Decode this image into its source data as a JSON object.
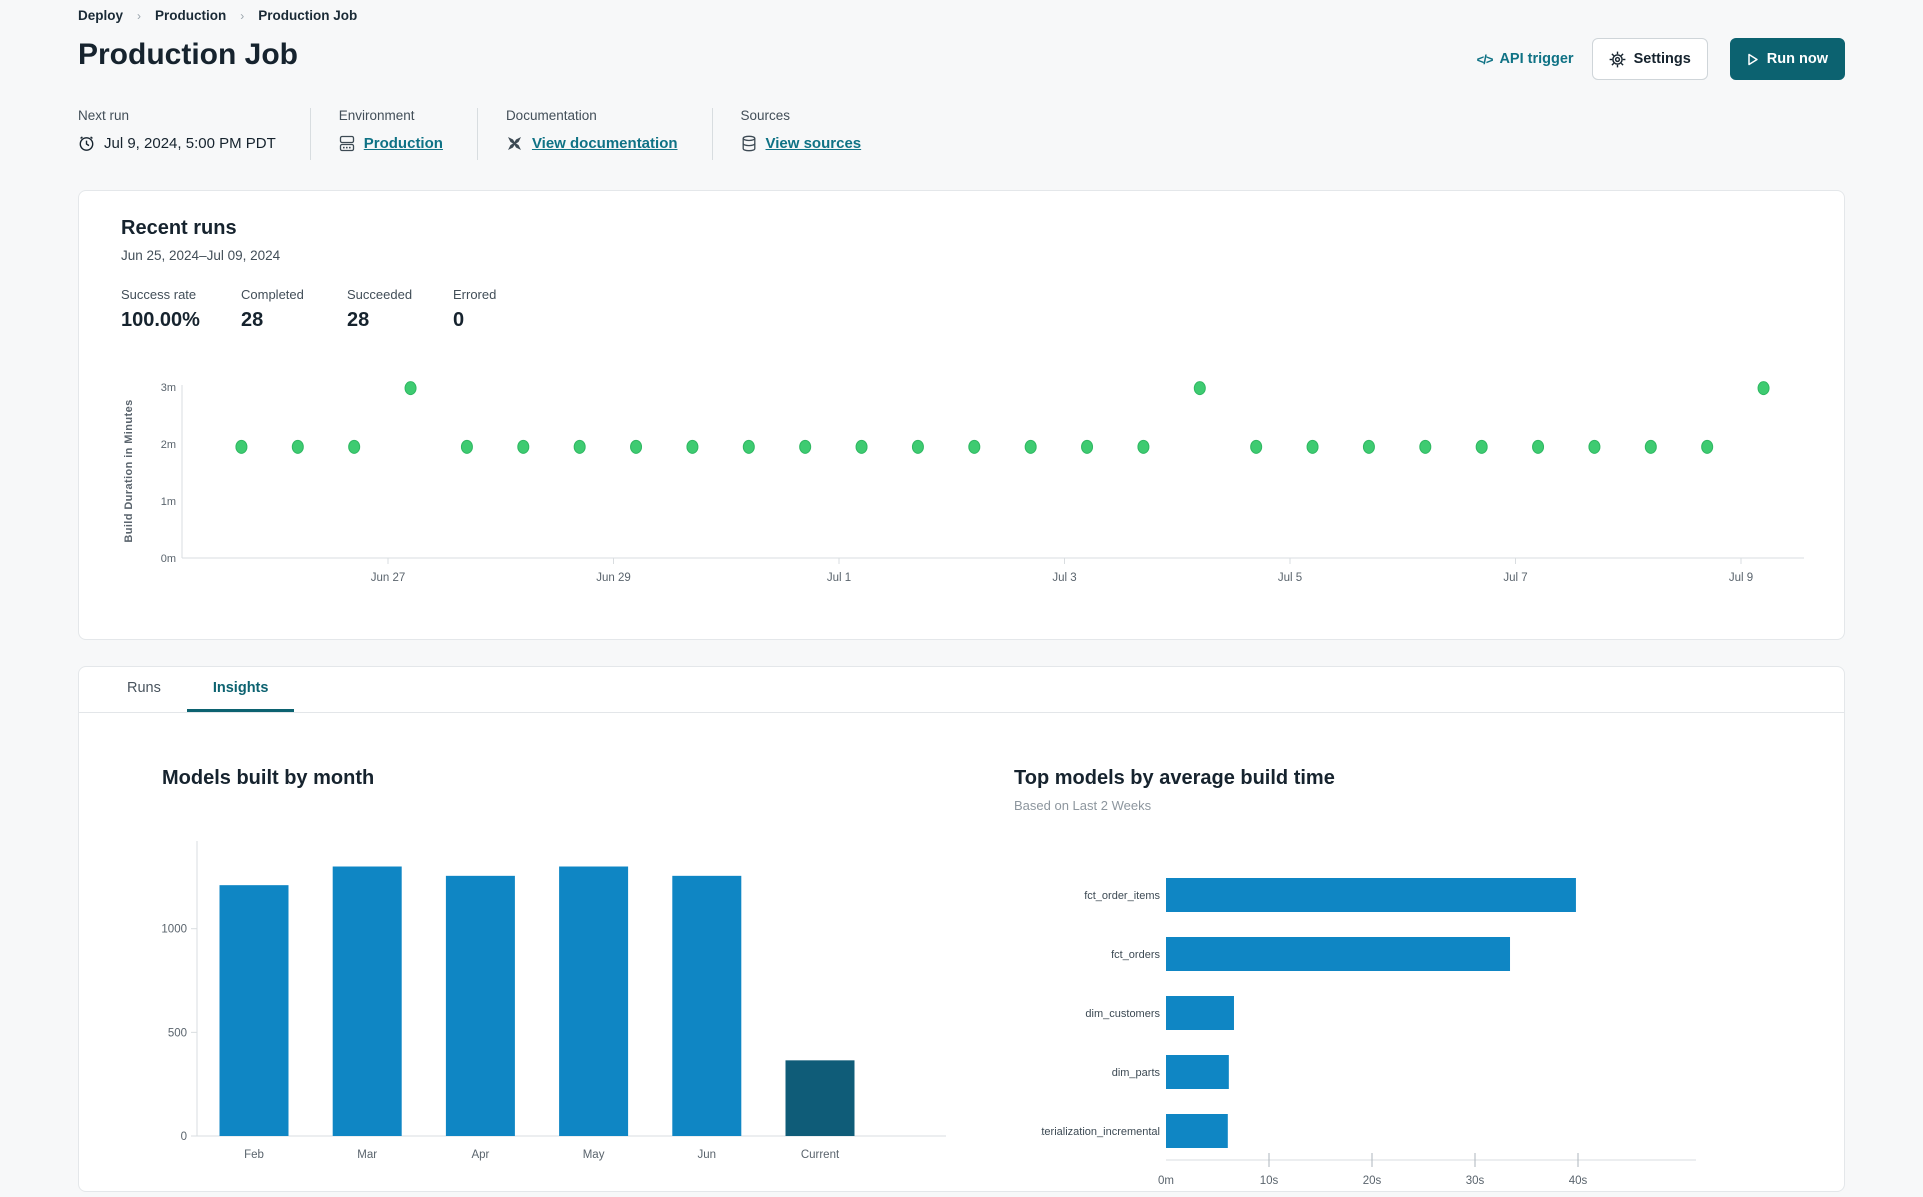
{
  "breadcrumb": {
    "items": [
      {
        "label": "Deploy"
      },
      {
        "label": "Production"
      },
      {
        "label": "Production Job"
      }
    ]
  },
  "header": {
    "title": "Production Job",
    "api_trigger_label": "API trigger",
    "api_trigger_glyph": "</>",
    "settings_label": "Settings",
    "run_now_label": "Run now"
  },
  "meta": {
    "next_run": {
      "label": "Next run",
      "value": "Jul 9, 2024, 5:00 PM PDT"
    },
    "environment": {
      "label": "Environment",
      "value": "Production"
    },
    "documentation": {
      "label": "Documentation",
      "value": "View documentation"
    },
    "sources": {
      "label": "Sources",
      "value": "View sources"
    }
  },
  "recent_runs": {
    "title": "Recent runs",
    "date_range": "Jun 25, 2024–Jul 09, 2024",
    "stats": [
      {
        "label": "Success rate",
        "value": "100.00%"
      },
      {
        "label": "Completed",
        "value": "28"
      },
      {
        "label": "Succeeded",
        "value": "28"
      },
      {
        "label": "Errored",
        "value": "0"
      }
    ]
  },
  "tabs": [
    {
      "label": "Runs",
      "active": false
    },
    {
      "label": "Insights",
      "active": true
    }
  ],
  "colors": {
    "accent_teal": "#0c6270",
    "link_teal": "#0f7285",
    "dot_green": "#3ecb71",
    "dot_green_edge": "#2fb862",
    "bar_blue": "#0f86c4",
    "bar_current_dark": "#0f5c78",
    "axis_text": "#5a646d",
    "axis_line": "#d9dde0"
  },
  "chart_data": [
    {
      "id": "build-duration-scatter",
      "type": "scatter",
      "ylabel": "Build Duration in Minutes",
      "y_ticks": [
        {
          "label": "0m",
          "minutes": 0
        },
        {
          "label": "1m",
          "minutes": 1
        },
        {
          "label": "2m",
          "minutes": 2
        },
        {
          "label": "3m",
          "minutes": 3
        }
      ],
      "x_ticks": [
        {
          "label": "Jun 27",
          "day": 2
        },
        {
          "label": "Jun 29",
          "day": 4
        },
        {
          "label": "Jul 1",
          "day": 6
        },
        {
          "label": "Jul 3",
          "day": 8
        },
        {
          "label": "Jul 5",
          "day": 10
        },
        {
          "label": "Jul 7",
          "day": 12
        },
        {
          "label": "Jul 9",
          "day": 14
        }
      ],
      "ylim": [
        0,
        3.2
      ],
      "points": [
        {
          "day": 0.7,
          "minutes": 1.95
        },
        {
          "day": 1.2,
          "minutes": 1.95
        },
        {
          "day": 1.7,
          "minutes": 1.95
        },
        {
          "day": 2.2,
          "minutes": 2.98
        },
        {
          "day": 2.7,
          "minutes": 1.95
        },
        {
          "day": 3.2,
          "minutes": 1.95
        },
        {
          "day": 3.7,
          "minutes": 1.95
        },
        {
          "day": 4.2,
          "minutes": 1.95
        },
        {
          "day": 4.7,
          "minutes": 1.95
        },
        {
          "day": 5.2,
          "minutes": 1.95
        },
        {
          "day": 5.7,
          "minutes": 1.95
        },
        {
          "day": 6.2,
          "minutes": 1.95
        },
        {
          "day": 6.7,
          "minutes": 1.95
        },
        {
          "day": 7.2,
          "minutes": 1.95
        },
        {
          "day": 7.7,
          "minutes": 1.95
        },
        {
          "day": 8.2,
          "minutes": 1.95
        },
        {
          "day": 8.7,
          "minutes": 1.95
        },
        {
          "day": 9.2,
          "minutes": 2.98
        },
        {
          "day": 9.7,
          "minutes": 1.95
        },
        {
          "day": 10.2,
          "minutes": 1.95
        },
        {
          "day": 10.7,
          "minutes": 1.95
        },
        {
          "day": 11.2,
          "minutes": 1.95
        },
        {
          "day": 11.7,
          "minutes": 1.95
        },
        {
          "day": 12.2,
          "minutes": 1.95
        },
        {
          "day": 12.7,
          "minutes": 1.95
        },
        {
          "day": 13.2,
          "minutes": 1.95
        },
        {
          "day": 13.7,
          "minutes": 1.95
        },
        {
          "day": 14.2,
          "minutes": 2.98
        }
      ]
    },
    {
      "id": "models-built-by-month",
      "type": "bar",
      "title": "Models built by month",
      "categories": [
        "Feb",
        "Mar",
        "Apr",
        "May",
        "Jun",
        "Current"
      ],
      "values": [
        1210,
        1300,
        1255,
        1300,
        1255,
        365
      ],
      "y_ticks": [
        0,
        500,
        1000
      ],
      "ylim": [
        0,
        1440
      ],
      "highlight_index": 5
    },
    {
      "id": "top-models-by-build-time",
      "type": "horizontal-bar",
      "title": "Top models by average build time",
      "subtitle": "Based on Last 2 Weeks",
      "categories": [
        "fct_order_items",
        "fct_orders",
        "dim_customers",
        "dim_parts",
        "materialization_incremental"
      ],
      "values_seconds": [
        39.8,
        33.4,
        6.6,
        6.1,
        6.0
      ],
      "x_ticks": [
        {
          "label": "0m",
          "s": 0
        },
        {
          "label": "10s",
          "s": 10
        },
        {
          "label": "20s",
          "s": 20
        },
        {
          "label": "30s",
          "s": 30
        },
        {
          "label": "40s",
          "s": 40
        }
      ],
      "xlim": [
        0,
        44
      ]
    }
  ]
}
